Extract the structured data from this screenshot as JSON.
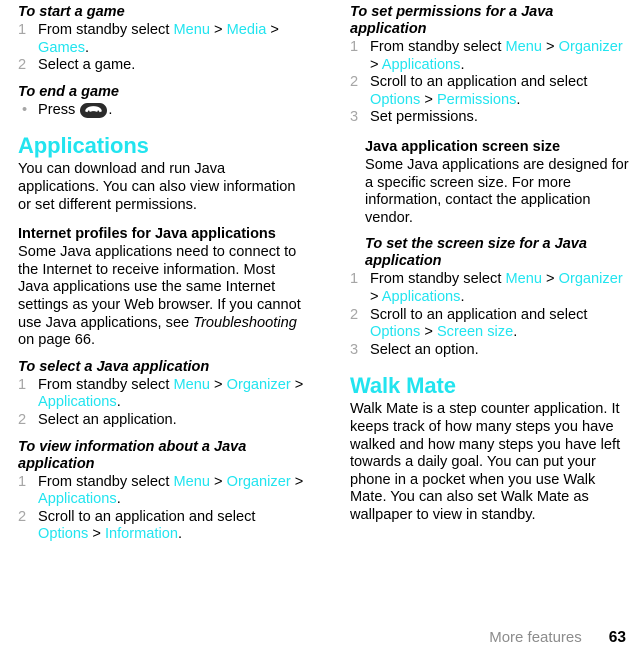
{
  "footer": {
    "section": "More features",
    "page_number": "63"
  },
  "accent_color": "#22e4ef",
  "left_column": {
    "start_game": {
      "heading": "To start a game",
      "step1_pre": "From standby select ",
      "step1_menu": "Menu",
      "step1_sep1": " > ",
      "step1_media": "Media",
      "step1_sep2": " > ",
      "step1_games": "Games",
      "step1_end": ".",
      "step2": "Select a game."
    },
    "end_game": {
      "heading": "To end a game",
      "bullet_pre": "Press ",
      "bullet_icon": "end-call-key-icon",
      "bullet_end": "."
    },
    "applications": {
      "heading": "Applications",
      "intro": "You can download and run Java applications. You can also view information or set different permissions."
    },
    "internet_profiles": {
      "heading": "Internet profiles for Java applications",
      "body_pre": "Some Java applications need to connect to the Internet to receive information. Most Java applications use the same Internet settings as your Web browser. If you cannot use Java applications, see ",
      "body_italic": "Troubleshooting",
      "body_post": " on page 66."
    },
    "select_java_app": {
      "heading": "To select a Java application",
      "step1_pre": "From standby select ",
      "step1_menu": "Menu",
      "step1_sep1": " > ",
      "step1_organizer": "Organizer",
      "step1_sep2": " > ",
      "step1_applications": "Applications",
      "step1_end": ".",
      "step2": "Select an application."
    },
    "view_info_java_app": {
      "heading": "To view information about a Java application",
      "step1_pre": "From standby select ",
      "step1_menu": "Menu",
      "step1_sep1": " > ",
      "step1_organizer": "Organizer",
      "step1_sep2": " > ",
      "step1_applications": "Applications",
      "step1_end": ".",
      "step2_pre": "Scroll to an application and select ",
      "step2_options": "Options",
      "step2_sep": " > ",
      "step2_information": "Information",
      "step2_end": "."
    }
  },
  "right_column": {
    "set_permissions": {
      "heading": "To set permissions for a Java application",
      "step1_pre": "From standby select ",
      "step1_menu": "Menu",
      "step1_sep1": " > ",
      "step1_organizer": "Organizer",
      "step1_sep2": " > ",
      "step1_applications": "Applications",
      "step1_end": ".",
      "step2_pre": "Scroll to an application and select ",
      "step2_options": "Options",
      "step2_sep": " > ",
      "step2_permissions": "Permissions",
      "step2_end": ".",
      "step3": "Set permissions."
    },
    "screen_size": {
      "heading": "Java application screen size",
      "body": "Some Java applications are designed for a specific screen size. For more information, contact the application vendor."
    },
    "set_screen_size": {
      "heading": "To set the screen size for a Java application",
      "step1_pre": "From standby select ",
      "step1_menu": "Menu",
      "step1_sep1": " > ",
      "step1_organizer": "Organizer",
      "step1_sep2": " > ",
      "step1_applications": "Applications",
      "step1_end": ".",
      "step2_pre": "Scroll to an application and select ",
      "step2_options": "Options",
      "step2_sep": " > ",
      "step2_screen_size": "Screen size",
      "step2_end": ".",
      "step3": "Select an option."
    },
    "walk_mate": {
      "heading": "Walk Mate",
      "body": "Walk Mate is a step counter application. It keeps track of how many steps you have walked and how many steps you have left towards a daily goal. You can put your phone in a pocket when you use Walk Mate. You can also set Walk Mate as wallpaper to view in standby."
    }
  },
  "list_markers": {
    "one": "1",
    "two": "2",
    "three": "3",
    "bullet": "•"
  }
}
